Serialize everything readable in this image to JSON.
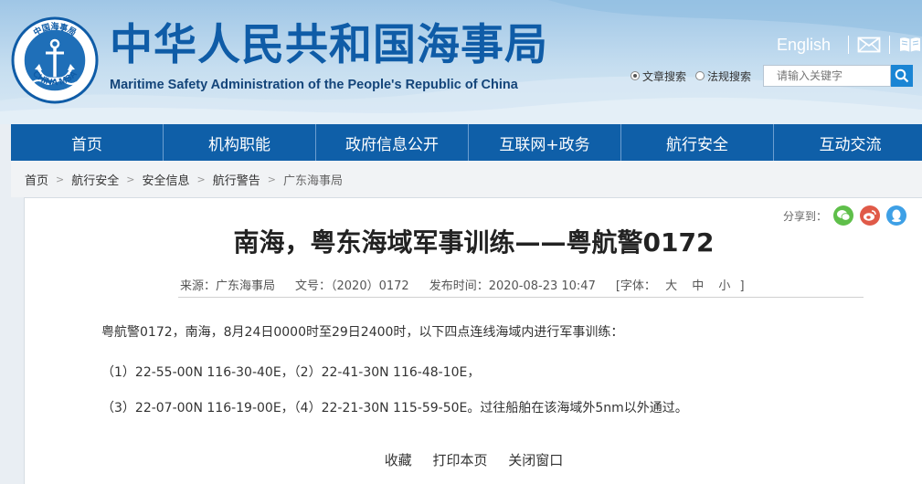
{
  "header": {
    "title_cn": "中华人民共和国海事局",
    "title_en": "Maritime Safety Administration of the People's Republic of China",
    "logo": {
      "top_text": "中国海事局",
      "bottom_text": "CHINA MSA"
    },
    "english_link": "English",
    "tools": [
      "mail-icon",
      "book-icon"
    ],
    "search": {
      "options": [
        "文章搜索",
        "法规搜索"
      ],
      "selected": "文章搜索",
      "placeholder": "请输入关键字"
    }
  },
  "nav": {
    "items": [
      "首页",
      "机构职能",
      "政府信息公开",
      "互联网+政务",
      "航行安全",
      "互动交流"
    ]
  },
  "breadcrumb": [
    "首页",
    "航行安全",
    "安全信息",
    "航行警告",
    "广东海事局"
  ],
  "article": {
    "share_label": "分享到：",
    "title": "南海，粤东海域军事训练——粤航警0172",
    "meta": {
      "source": "来源：广东海事局",
      "doc_no": "文号：（2020）0172",
      "published": "发布时间：2020-08-23 10:47",
      "font_label": "[字体：",
      "font_sizes": [
        "大",
        "中",
        "小"
      ],
      "font_close": "]"
    },
    "paragraphs": [
      "粤航警0172，南海，8月24日0000时至29日2400时，以下四点连线海域内进行军事训练：",
      "（1）22-55-00N 116-30-40E，（2）22-41-30N 116-48-10E，",
      "（3）22-07-00N 116-19-00E，（4）22-21-30N 115-59-50E。过往船舶在该海域外5nm以外通过。"
    ],
    "actions": [
      "收藏",
      "打印本页",
      "关闭窗口"
    ]
  },
  "colors": {
    "brand_blue": "#0f5fa8",
    "title_blue": "#0f5ca7",
    "wechat_green": "#5fbf4a",
    "weibo_red": "#e05a48",
    "qq_blue": "#3ea0e6"
  }
}
